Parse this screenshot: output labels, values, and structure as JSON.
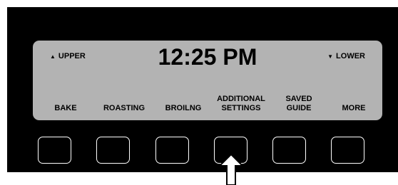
{
  "display": {
    "upper_zone": "UPPER",
    "lower_zone": "LOWER",
    "upper_icon": "triangle-up-icon",
    "lower_icon": "triangle-down-icon",
    "time": "12:25 PM"
  },
  "soft_keys": [
    {
      "lines": [
        "BAKE"
      ]
    },
    {
      "lines": [
        "ROASTING"
      ]
    },
    {
      "lines": [
        "BROILNG"
      ]
    },
    {
      "lines": [
        "ADDITIONAL",
        "SETTINGS"
      ]
    },
    {
      "lines": [
        "SAVED",
        "GUIDE"
      ]
    },
    {
      "lines": [
        "MORE"
      ]
    }
  ],
  "pointer": {
    "icon": "arrow-up-icon",
    "points_to_key": 4
  },
  "colors": {
    "panel": "#000000",
    "lcd": "#b3b3b3",
    "key_border": "#ffffff"
  }
}
